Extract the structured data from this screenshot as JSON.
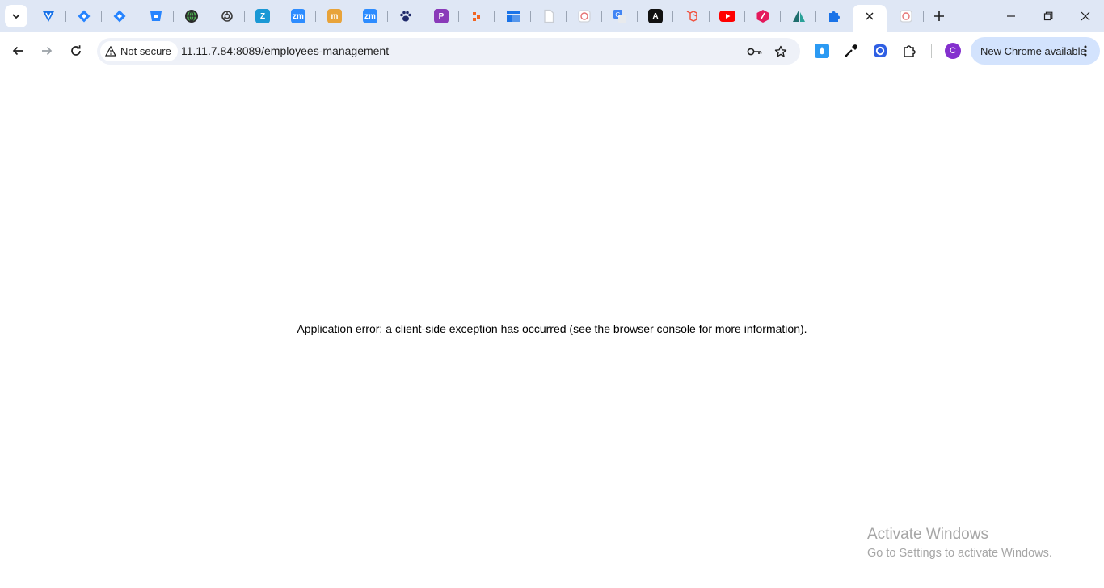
{
  "browser": {
    "tabs": [
      {
        "icon": "vpn-triangle-icon",
        "color": "#1a73e8"
      },
      {
        "icon": "jira-diamond-icon",
        "color": "#2684ff"
      },
      {
        "icon": "jira-diamond-icon",
        "color": "#2684ff"
      },
      {
        "icon": "bitbucket-bucket-icon",
        "color": "#2684ff"
      },
      {
        "icon": "green-globe-icon",
        "color": "#4caf50"
      },
      {
        "icon": "openai-icon",
        "color": "#3c3c3c"
      },
      {
        "icon": "z-letter-icon",
        "color": "#1a98d5",
        "glyph": "Z"
      },
      {
        "icon": "zoom-icon",
        "color": "#2d8cff",
        "glyph": "zm"
      },
      {
        "icon": "m-letter-icon",
        "color": "#e8a33a",
        "glyph": "m"
      },
      {
        "icon": "zoom-icon",
        "color": "#2d8cff",
        "glyph": "zm"
      },
      {
        "icon": "paw-icon",
        "color": "#1f2a6b"
      },
      {
        "icon": "p-letter-icon",
        "color": "#8a3ab9",
        "glyph": "P"
      },
      {
        "icon": "orange-plus-icon",
        "color": "#f26522"
      },
      {
        "icon": "layout-grid-icon",
        "color": "#1a73e8"
      },
      {
        "icon": "blank-page-icon",
        "color": "#c9cdd4"
      },
      {
        "icon": "red-circle-page-icon",
        "color": "#e57373"
      },
      {
        "icon": "translate-icon",
        "color": "#4285f4"
      },
      {
        "icon": "a-letter-icon",
        "color": "#111111",
        "glyph": "A"
      },
      {
        "icon": "laravel-icon",
        "color": "#f05340"
      },
      {
        "icon": "youtube-icon",
        "color": "#ff0000"
      },
      {
        "icon": "cube-icon",
        "color": "#e4195c"
      },
      {
        "icon": "sail-icon",
        "color": "#1e6e6e"
      },
      {
        "icon": "puzzle-icon",
        "color": "#1a73e8"
      },
      {
        "icon": "close-icon",
        "color": "#1f1f1f",
        "active": true
      },
      {
        "icon": "red-circle-page-icon",
        "color": "#e57373"
      }
    ],
    "address": {
      "security_label": "Not secure",
      "url": "11.11.7.84:8089/employees-management"
    },
    "profile_initial": "C",
    "update_label": "New Chrome available"
  },
  "page": {
    "error_message": "Application error: a client-side exception has occurred (see the browser console for more information)."
  },
  "watermark": {
    "title": "Activate Windows",
    "subtitle": "Go to Settings to activate Windows."
  }
}
